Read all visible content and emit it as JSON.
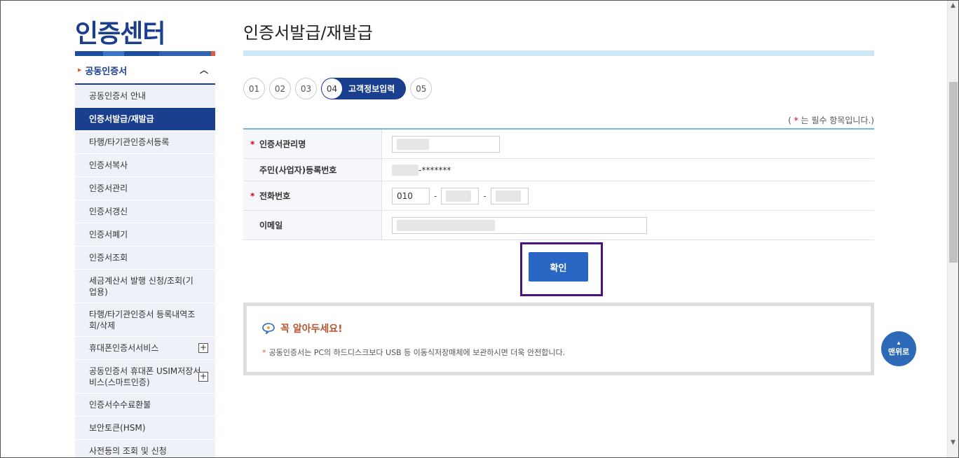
{
  "sidebar": {
    "title": "인증센터",
    "section": "공동인증서",
    "items": [
      {
        "label": "공동인증서 안내"
      },
      {
        "label": "인증서발급/재발급"
      },
      {
        "label": "타행/타기관인증서등록"
      },
      {
        "label": "인증서복사"
      },
      {
        "label": "인증서관리"
      },
      {
        "label": "인증서갱신"
      },
      {
        "label": "인증서폐기"
      },
      {
        "label": "인증서조회"
      },
      {
        "label": "세금계산서 발행 신청/조회(기업용)"
      },
      {
        "label": "타행/타기관인증서 등록내역조회/삭제"
      },
      {
        "label": "휴대폰인증서서비스"
      },
      {
        "label": "공동인증서 휴대폰 USIM저장서비스(스마트인증)"
      },
      {
        "label": "인증서수수료환불"
      },
      {
        "label": "보안토큰(HSM)"
      },
      {
        "label": "사전등의 조회 및 신청"
      }
    ]
  },
  "main": {
    "title": "인증서발급/재발급",
    "steps": [
      {
        "num": "01"
      },
      {
        "num": "02"
      },
      {
        "num": "03"
      },
      {
        "num": "04",
        "label": "고객정보입력"
      },
      {
        "num": "05"
      }
    ],
    "required_note": {
      "open": "(",
      "star": "*",
      "text": "는 필수 항목입니다.)"
    },
    "form": {
      "cert_name_label": "인증서관리명",
      "resident_label": "주민(사업자)등록번호",
      "resident_value_suffix": "-*******",
      "phone_label": "전화번호",
      "phone_prefix": "010",
      "email_label": "이메일",
      "required_star": "*"
    },
    "confirm_label": "확인",
    "notice": {
      "title": "꼭 알아두세요!",
      "star": "*",
      "text": "공동인증서는 PC의 하드디스크보다 USB 등 이동식저장매체에 보관하시면 더욱 안전합니다."
    },
    "top_button_label": "맨위로"
  },
  "colors": {
    "primary": "#1a3f8f",
    "accent_blue": "#2a66c4",
    "highlight_border": "#4b1380",
    "required_red": "#d0021b"
  }
}
